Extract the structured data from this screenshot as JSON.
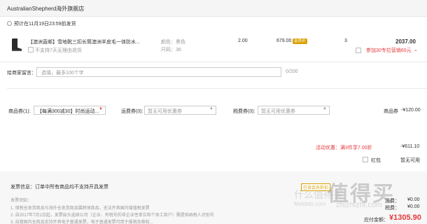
{
  "store": {
    "name": "AustralianShepherd海外旗舰店"
  },
  "delivery": {
    "text": "预计在11月19日23:59前发货"
  },
  "product": {
    "title": "【澳洲直邮】雪地靴三扣长筒澳洲羊皮毛一体防水...",
    "return_policy": "不支持7天无理由退货",
    "color": "颜色：黑色",
    "size": "尺码：36",
    "unit_price": "2.00",
    "member_price": "679.00",
    "member_badge": "会员价",
    "quantity": "3",
    "subtotal": "2037.00",
    "promo": "参加30专拉营销60元"
  },
  "message": {
    "label": "给商家留言：",
    "placeholder": "选填，最多100个字",
    "counter": "0/200"
  },
  "coupons": {
    "merchant_label": "商品券(1):",
    "merchant_value": "【每满300减30】时尚运动...",
    "shipping_label": "运费券(0):",
    "shipping_value": "暂无可用优惠券",
    "tax_label": "税费券(0):",
    "tax_value": "暂无可用优惠券",
    "merchant_discount_label": "商品券",
    "merchant_discount_value": "-¥120.00"
  },
  "activity": {
    "label": "活动优惠：满3件享7.00折",
    "amount": "-¥611.10"
  },
  "red_packet": {
    "label": "红包",
    "status": "暂无可用"
  },
  "invoice": {
    "label": "发票信息：订单中所有商品均不支持开具发票"
  },
  "notes": [
    "发票须知：",
    "1. 保税仓发货商品与海外仓发货商品属跨境商品，无法开具国内增值税发票",
    "2. 自2017年7月1日起，发票抬头选择公司（企业、有税号的非企业性单位和个体工商户）需提供纳税人识别号",
    "3. 自营国内仓商品支持开具电子普通发票，电子普通发票可用于报销及维权..."
  ],
  "summary": {
    "member_tag": "已含会员折扣",
    "shipping_label": "运费：",
    "shipping_value": "¥0.00",
    "tax_label": "税费：",
    "tax_value": "¥0.00",
    "total_label": "应付金额：",
    "total_value": "¥1305.90"
  },
  "watermark": {
    "text1": "值得买",
    "text2": "什么值得买",
    "site1": "Meidebi.com",
    "site2": "zhizhizhi.com"
  },
  "colors": {
    "accent": "#e4393c",
    "vip": "#d9a000"
  }
}
